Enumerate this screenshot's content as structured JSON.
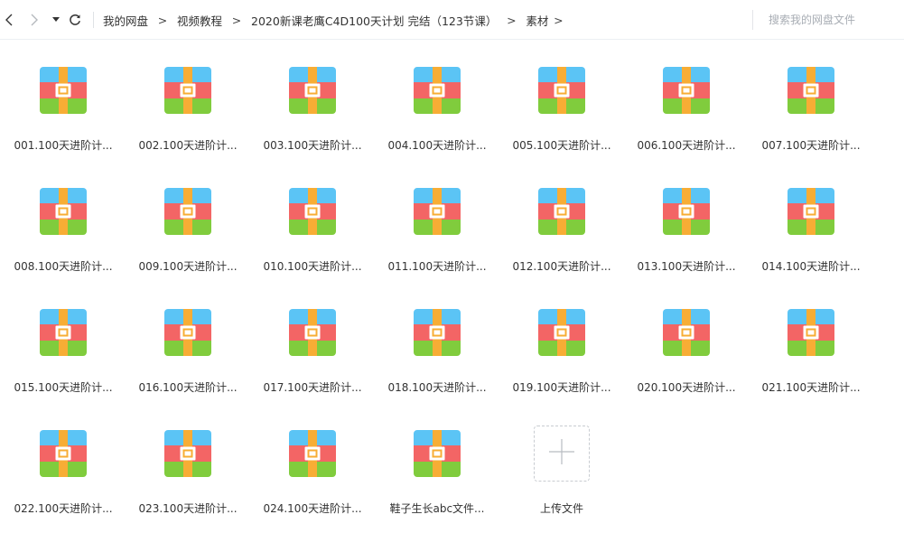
{
  "breadcrumb": {
    "items": [
      "我的网盘",
      "视频教程",
      "2020新课老鹰C4D100天计划 完结（123节课）",
      "素材"
    ],
    "separator": ">"
  },
  "search": {
    "placeholder": "搜索我的网盘文件",
    "value": ""
  },
  "icons": {
    "back": "chevron-left-icon",
    "forward": "chevron-right-icon",
    "dropdown": "caret-down-icon",
    "refresh": "refresh-icon",
    "file": "archive-icon",
    "upload": "plus-icon"
  },
  "colors": {
    "archive_top": "#5bc4f5",
    "archive_middle": "#f36565",
    "archive_bottom": "#80cc3d",
    "archive_strap": "#f7ad35",
    "upload_border": "#c8ccd1"
  },
  "files": [
    "001.100天进阶计...",
    "002.100天进阶计...",
    "003.100天进阶计...",
    "004.100天进阶计...",
    "005.100天进阶计...",
    "006.100天进阶计...",
    "007.100天进阶计...",
    "008.100天进阶计...",
    "009.100天进阶计...",
    "010.100天进阶计...",
    "011.100天进阶计...",
    "012.100天进阶计...",
    "013.100天进阶计...",
    "014.100天进阶计...",
    "015.100天进阶计...",
    "016.100天进阶计...",
    "017.100天进阶计...",
    "018.100天进阶计...",
    "019.100天进阶计...",
    "020.100天进阶计...",
    "021.100天进阶计...",
    "022.100天进阶计...",
    "023.100天进阶计...",
    "024.100天进阶计...",
    "鞋子生长abc文件..."
  ],
  "upload": {
    "label": "上传文件"
  }
}
